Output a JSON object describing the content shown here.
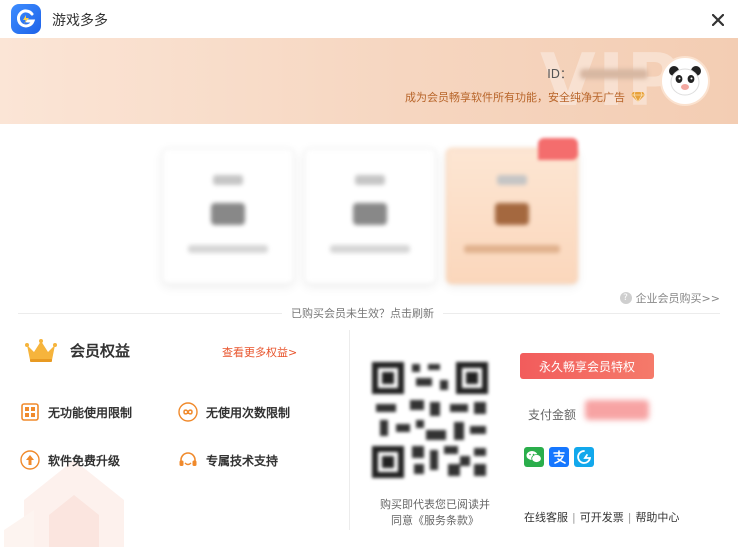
{
  "window": {
    "title": "游戏多多"
  },
  "colors": {
    "accent": "#f25c5c",
    "brand": "#1e62e8",
    "gold": "#f6b43c",
    "link": "#e8542c"
  },
  "banner": {
    "id_label": "ID：",
    "tip": "成为会员畅享软件所有功能，安全纯净无广告"
  },
  "enterprise": {
    "label": "企业会员购买>>"
  },
  "refresh_tip": "已购买会员未生效？点击刷新",
  "benefits": {
    "title": "会员权益",
    "more": "查看更多权益>",
    "items": [
      {
        "label": "无功能使用限制",
        "icon": "grid-icon"
      },
      {
        "label": "无使用次数限制",
        "icon": "infinity-icon"
      },
      {
        "label": "软件免费升级",
        "icon": "upgrade-icon"
      },
      {
        "label": "专属技术支持",
        "icon": "headset-icon"
      }
    ]
  },
  "payment": {
    "forever_label": "永久畅享会员特权",
    "amount_label": "支付金额",
    "agree_line1": "购买即代表您已阅读并",
    "agree_line2_prefix": "同意",
    "agree_terms": "《服务条款》",
    "methods": [
      "wechat-pay-icon",
      "alipay-icon",
      "qq-pay-icon"
    ]
  },
  "footer": {
    "links": [
      "在线客服",
      "可开发票",
      "帮助中心"
    ],
    "separator": "|"
  }
}
